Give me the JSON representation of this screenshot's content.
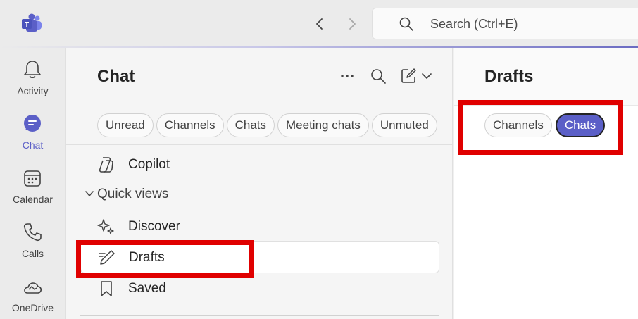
{
  "topbar": {
    "search_placeholder": "Search (Ctrl+E)"
  },
  "rail": {
    "items": [
      {
        "label": "Activity",
        "icon": "bell-icon"
      },
      {
        "label": "Chat",
        "icon": "chat-icon",
        "active": true
      },
      {
        "label": "Calendar",
        "icon": "calendar-icon"
      },
      {
        "label": "Calls",
        "icon": "phone-icon"
      },
      {
        "label": "OneDrive",
        "icon": "cloud-icon"
      }
    ]
  },
  "chat_pane": {
    "title": "Chat",
    "filters": [
      "Unread",
      "Channels",
      "Chats",
      "Meeting chats",
      "Unmuted"
    ],
    "copilot": "Copilot",
    "quick_views_label": "Quick views",
    "quick_views": [
      "Discover",
      "Drafts",
      "Saved"
    ]
  },
  "drafts_pane": {
    "title": "Drafts",
    "filters": [
      "Channels",
      "Chats"
    ],
    "selected_filter": "Chats"
  },
  "colors": {
    "accent": "#5b5fc7",
    "highlight": "#e00000"
  }
}
